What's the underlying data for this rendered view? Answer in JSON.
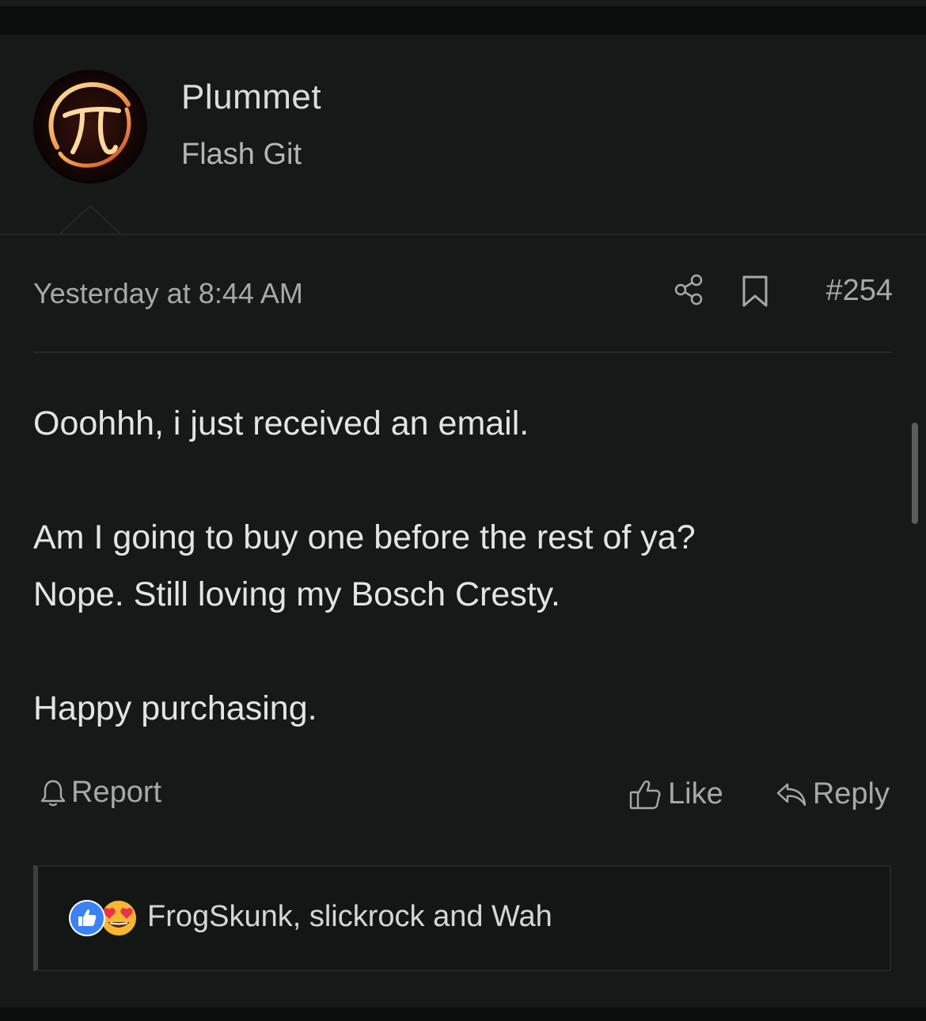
{
  "post": {
    "username": "Plummet",
    "user_title": "Flash Git",
    "timestamp": "Yesterday at 8:44 AM",
    "post_number": "#254",
    "message": [
      "Ooohhh, i just received an email.",
      "Am I going to buy one before the rest of ya?",
      "Nope. Still loving my Bosch Cresty.",
      "Happy purchasing."
    ],
    "actions": {
      "report_label": "Report",
      "like_label": "Like",
      "reply_label": "Reply"
    },
    "reactions": {
      "users_text": "FrogSkunk, slickrock and Wah",
      "icons": [
        "thumbs-up-reaction-icon",
        "heart-eyes-reaction-icon"
      ]
    }
  },
  "colors": {
    "background": "#151917",
    "text_primary": "#e4e4e4",
    "text_muted": "#a8a8a8",
    "like_blue": "#3b82f6",
    "emoji_yellow": "#f7b731"
  }
}
